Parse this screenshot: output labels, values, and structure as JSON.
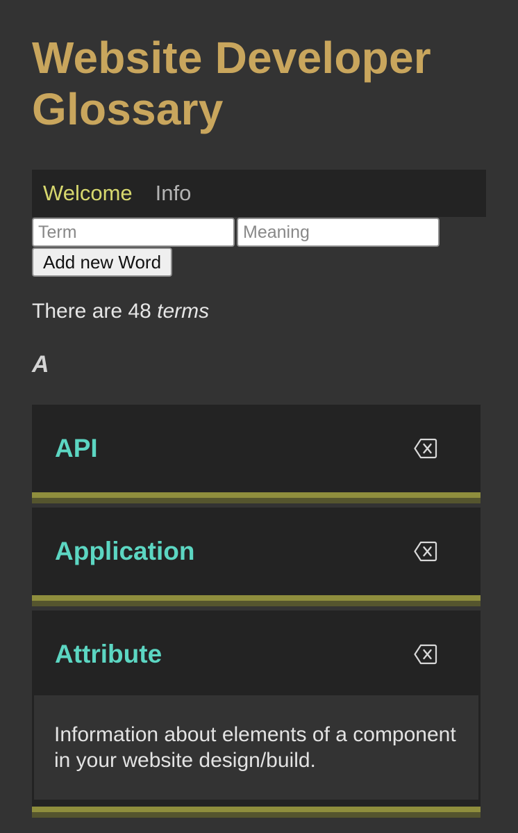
{
  "header": {
    "title": "Website Developer Glossary"
  },
  "nav": {
    "items": [
      {
        "label": "Welcome",
        "active": true
      },
      {
        "label": "Info",
        "active": false
      }
    ]
  },
  "form": {
    "term_placeholder": "Term",
    "meaning_placeholder": "Meaning",
    "term_value": "",
    "meaning_value": "",
    "add_label": "Add new Word"
  },
  "summary": {
    "prefix": "There are 48 ",
    "suffix": "terms"
  },
  "section": {
    "letter": "A"
  },
  "entries": [
    {
      "term": "API",
      "expanded": false,
      "meaning": "",
      "delete_icon": "backspace-icon"
    },
    {
      "term": "Application",
      "expanded": false,
      "meaning": "",
      "delete_icon": "backspace-icon"
    },
    {
      "term": "Attribute",
      "expanded": true,
      "meaning": "Information about elements of a component in your website design/build.",
      "delete_icon": "backspace-icon"
    }
  ],
  "colors": {
    "background": "#333333",
    "title": "#c9a65d",
    "nav_active": "#d7d86e",
    "term": "#5cd6c2",
    "card": "#232323",
    "stripe_top": "#8f8e3d",
    "stripe_bottom": "#55552e"
  }
}
